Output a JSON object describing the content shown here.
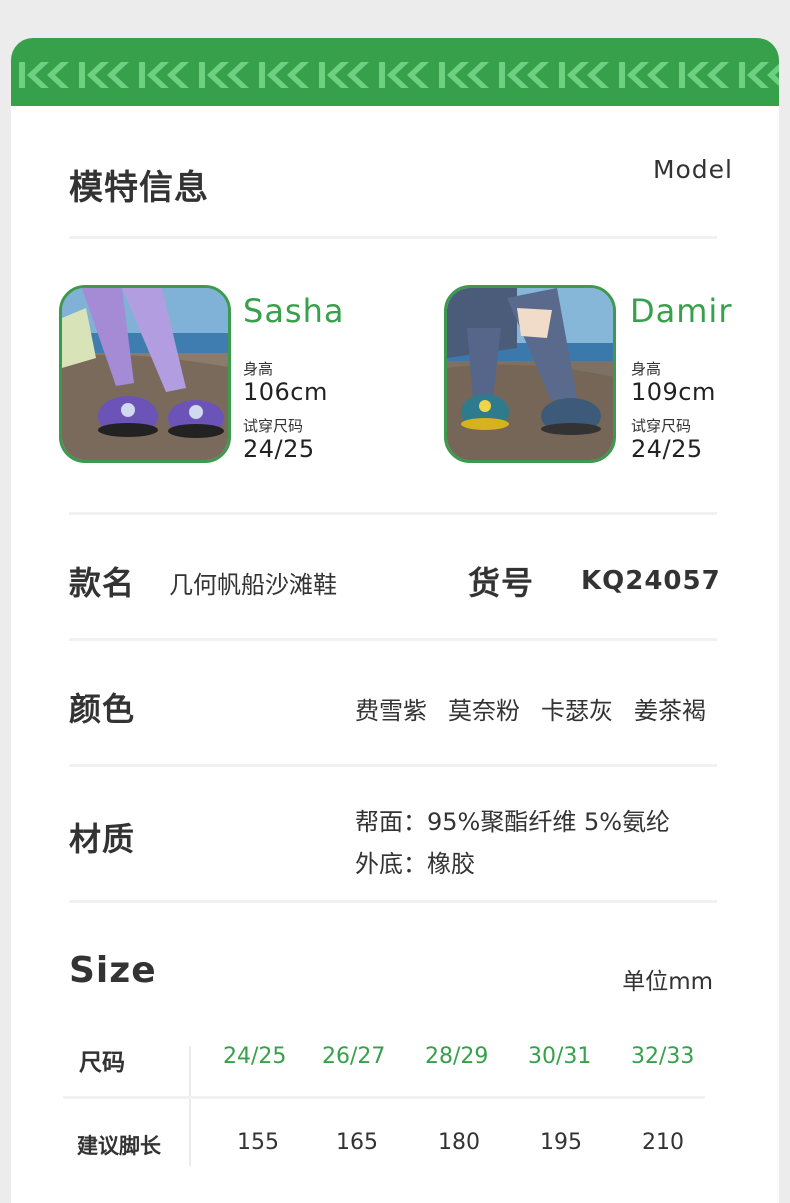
{
  "model_section": {
    "title": "模特信息",
    "title_en": "Model"
  },
  "models": [
    {
      "name": "Sasha",
      "height_label": "身高",
      "height": "106cm",
      "size_label": "试穿尺码",
      "size": "24/25"
    },
    {
      "name": "Damir",
      "height_label": "身高",
      "height": "109cm",
      "size_label": "试穿尺码",
      "size": "24/25"
    }
  ],
  "product": {
    "name_label": "款名",
    "name": "几何帆船沙滩鞋",
    "sku_label": "货号",
    "sku": "KQ24057"
  },
  "colors": {
    "label": "颜色",
    "values": [
      "费雪紫",
      "莫奈粉",
      "卡瑟灰",
      "姜茶褐"
    ]
  },
  "material": {
    "label": "材质",
    "upper": "帮面：95%聚酯纤维 5%氨纶",
    "sole": "外底：橡胶"
  },
  "size_section": {
    "title": "Size",
    "unit": "单位mm",
    "row_label_size": "尺码",
    "row_label_length": "建议脚长",
    "sizes": [
      "24/25",
      "26/27",
      "28/29",
      "30/31",
      "32/33"
    ],
    "lengths": [
      "155",
      "165",
      "180",
      "195",
      "210"
    ]
  },
  "theme": {
    "accent": "#37a04a",
    "band": "#37a04a"
  }
}
